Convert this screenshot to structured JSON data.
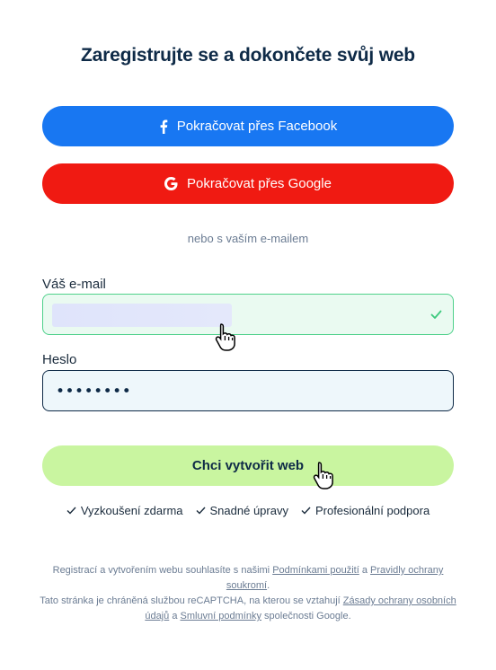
{
  "title": "Zaregistrujte se a dokončete svůj web",
  "social": {
    "facebook_label": "Pokračovat přes Facebook",
    "google_label": "Pokračovat přes Google",
    "facebook_color": "#1877f2",
    "google_color": "#f01a12"
  },
  "divider_text": "nebo s vaším e-mailem",
  "form": {
    "email_label": "Váš e-mail",
    "email_value": "",
    "password_label": "Heslo",
    "password_value": "••••••••",
    "submit_label": "Chci vytvořit web",
    "submit_color": "#c9f5a0"
  },
  "features": [
    {
      "label": "Vyzkoušení zdarma"
    },
    {
      "label": "Snadné úpravy"
    },
    {
      "label": "Profesionální podpora"
    }
  ],
  "legal": {
    "line1_text": "Registrací a vytvořením webu souhlasíte s našimi",
    "terms_link": "Podmínkami použití",
    "and1": "a",
    "privacy_link": "Pravidly ochrany soukromí",
    "period1": ".",
    "line2_text": "Tato stránka je chráněná službou reCAPTCHA, na kterou se vztahují",
    "google_privacy_link": "Zásady ochrany osobních údajů",
    "and2": "a",
    "google_terms_link": "Smluvní podmínky",
    "line2_end": "společnosti Google."
  },
  "icons": {
    "facebook": "facebook-icon",
    "google": "google-icon",
    "check": "check-icon",
    "cursor": "hand-cursor-icon"
  }
}
